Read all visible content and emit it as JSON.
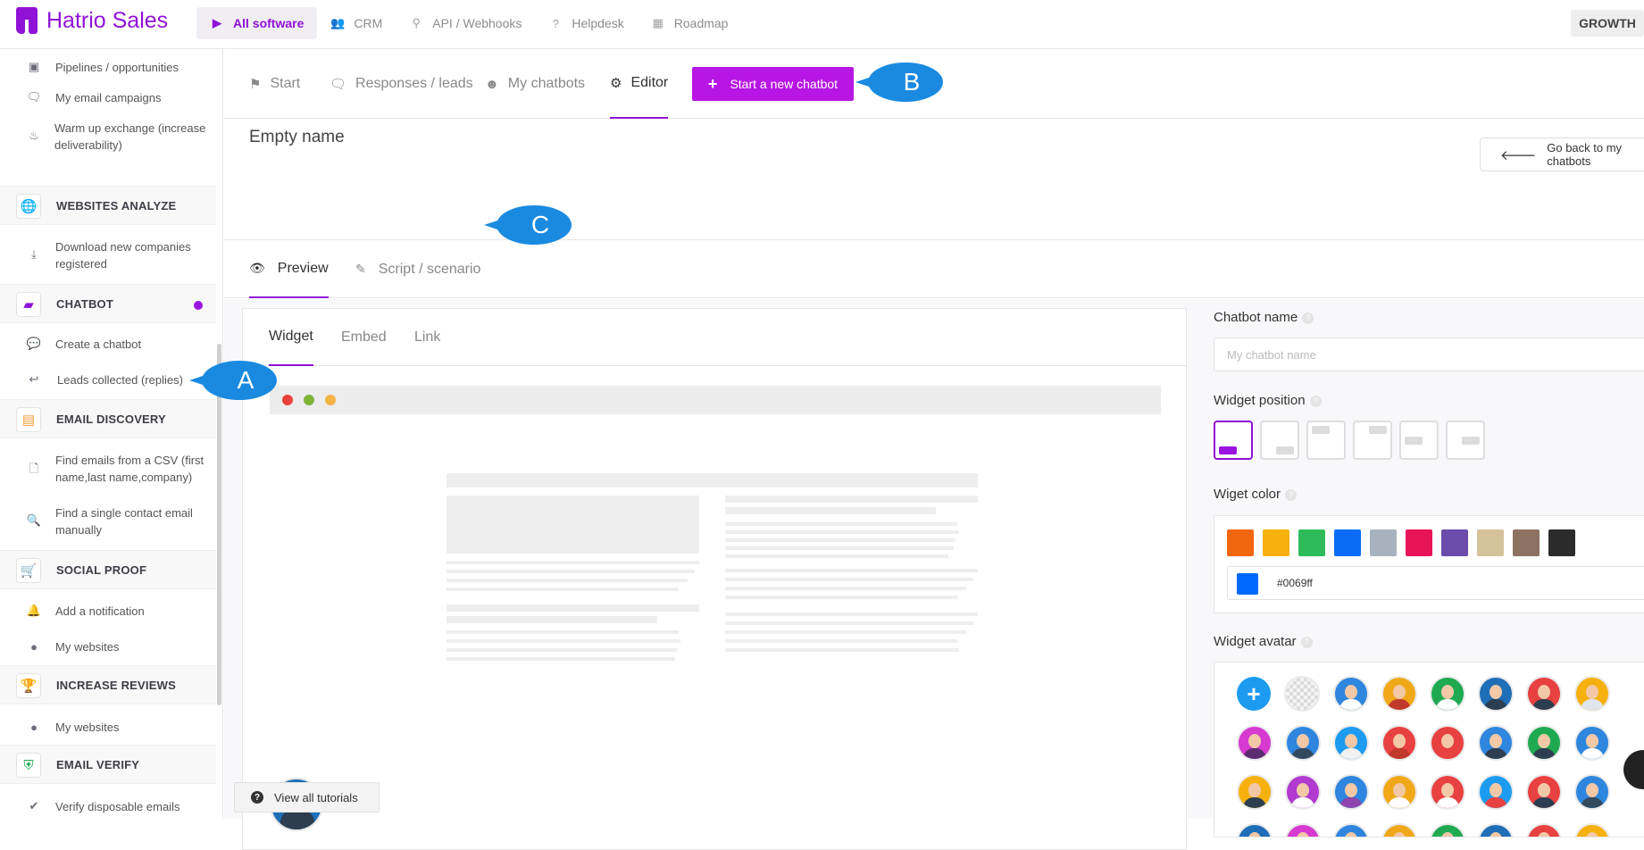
{
  "app": {
    "name": "Hatrio Sales",
    "plan": "GROWTH"
  },
  "topnav": [
    {
      "label": "All software",
      "icon": "play-icon"
    },
    {
      "label": "CRM",
      "icon": "users-icon"
    },
    {
      "label": "API / Webhooks",
      "icon": "plug-icon"
    },
    {
      "label": "Helpdesk",
      "icon": "question-icon"
    },
    {
      "label": "Roadmap",
      "icon": "calendar-icon"
    }
  ],
  "sidebar": {
    "items": [
      {
        "label": "Pipelines / opportunities"
      },
      {
        "label": "My email campaigns"
      },
      {
        "label": "Warm up exchange (increase deliverability)"
      },
      {
        "label": "Download new companies registered"
      },
      {
        "label": "Create a chatbot"
      },
      {
        "label": "Leads collected (replies)"
      },
      {
        "label": "Find emails from a CSV (first name,last name,company)"
      },
      {
        "label": "Find a single contact email manually"
      },
      {
        "label": "Add a notification"
      },
      {
        "label": "My websites"
      },
      {
        "label": "My websites"
      },
      {
        "label": "Verify disposable emails"
      }
    ],
    "sections": [
      {
        "label": "WEBSITES ANALYZE"
      },
      {
        "label": "CHATBOT"
      },
      {
        "label": "EMAIL DISCOVERY"
      },
      {
        "label": "SOCIAL PROOF"
      },
      {
        "label": "INCREASE REVIEWS"
      },
      {
        "label": "EMAIL VERIFY"
      }
    ]
  },
  "main": {
    "tabs": [
      {
        "label": "Start"
      },
      {
        "label": "Responses / leads"
      },
      {
        "label": "My chatbots"
      },
      {
        "label": "Editor"
      }
    ],
    "new_chatbot_label": "Start a new chatbot",
    "page_title": "Empty name",
    "back_label": "Go back to my chatbots",
    "subtabs": [
      {
        "label": "Preview"
      },
      {
        "label": "Script / scenario"
      }
    ],
    "preview_tabs": [
      {
        "label": "Widget"
      },
      {
        "label": "Embed"
      },
      {
        "label": "Link"
      }
    ],
    "tutorials_label": "View all tutorials"
  },
  "settings": {
    "name_label": "Chatbot name",
    "name_placeholder": "My chatbot name",
    "position_label": "Widget position",
    "color_label": "Wiget color",
    "colors": [
      "#f2660f",
      "#f6b10f",
      "#2ebc5b",
      "#0a6cf5",
      "#a8b2bf",
      "#e8145a",
      "#6b4bac",
      "#d5c29b",
      "#8e7261",
      "#2b2b2b"
    ],
    "hex_value": "#0069ff",
    "avatar_label": "Widget avatar"
  },
  "callouts": {
    "a": "A",
    "b": "B",
    "c": "C"
  }
}
